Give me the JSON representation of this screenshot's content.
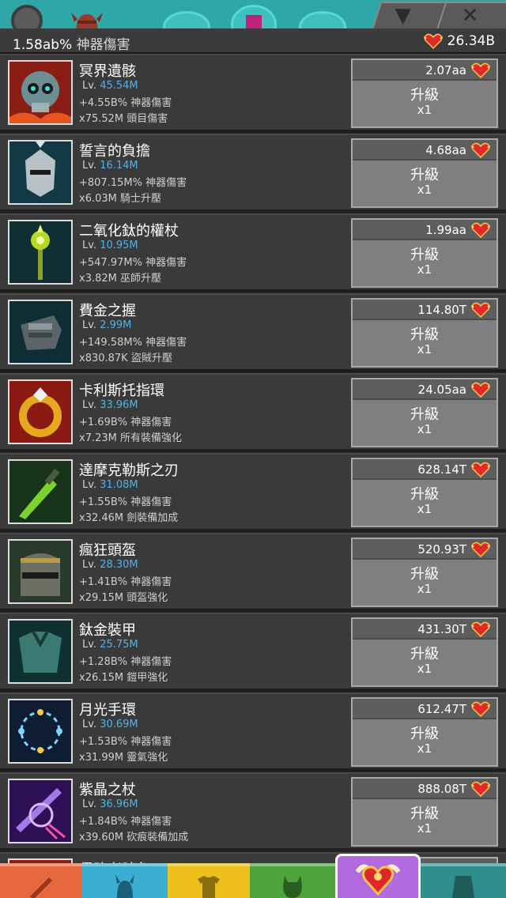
{
  "header": {
    "damage_value": "1.58ab%",
    "damage_label": "神器傷害",
    "currency_value": "26.34B",
    "currency_icon": "relic-heart-icon"
  },
  "list": {
    "items": [
      {
        "name": "冥界遺骸",
        "lv_label": "Lv.",
        "lv": "45.54M",
        "stat1": "+4.55B% 神器傷害",
        "stat2": "x75.52M 頭目傷害",
        "cost": "2.07aa",
        "button_label": "升級",
        "multiplier": "x1",
        "icon": "skull-icon"
      },
      {
        "name": "誓言的負擔",
        "lv_label": "Lv.",
        "lv": "16.14M",
        "stat1": "+807.15M% 神器傷害",
        "stat2": "x6.03M 騎士升壓",
        "cost": "4.68aa",
        "button_label": "升級",
        "multiplier": "x1",
        "icon": "knight-helm-icon"
      },
      {
        "name": "二氧化鈦的權杖",
        "lv_label": "Lv.",
        "lv": "10.95M",
        "stat1": "+547.97M% 神器傷害",
        "stat2": "x3.82M 巫師升壓",
        "cost": "1.99aa",
        "button_label": "升級",
        "multiplier": "x1",
        "icon": "scepter-icon"
      },
      {
        "name": "費金之握",
        "lv_label": "Lv.",
        "lv": "2.99M",
        "stat1": "+149.58M% 神器傷害",
        "stat2": "x830.87K 盜賊升壓",
        "cost": "114.80T",
        "button_label": "升級",
        "multiplier": "x1",
        "icon": "gauntlet-icon"
      },
      {
        "name": "卡利斯托指環",
        "lv_label": "Lv.",
        "lv": "33.96M",
        "stat1": "+1.69B% 神器傷害",
        "stat2": "x7.23M 所有裝備強化",
        "cost": "24.05aa",
        "button_label": "升級",
        "multiplier": "x1",
        "icon": "ring-icon"
      },
      {
        "name": "達摩克勒斯之刃",
        "lv_label": "Lv.",
        "lv": "31.08M",
        "stat1": "+1.55B% 神器傷害",
        "stat2": "x32.46M 劍裝備加成",
        "cost": "628.14T",
        "button_label": "升級",
        "multiplier": "x1",
        "icon": "blade-icon"
      },
      {
        "name": "瘋狂頭盔",
        "lv_label": "Lv.",
        "lv": "28.30M",
        "stat1": "+1.41B% 神器傷害",
        "stat2": "x29.15M 頭盔強化",
        "cost": "520.93T",
        "button_label": "升級",
        "multiplier": "x1",
        "icon": "helmet-icon"
      },
      {
        "name": "鈦金裝甲",
        "lv_label": "Lv.",
        "lv": "25.75M",
        "stat1": "+1.28B% 神器傷害",
        "stat2": "x26.15M 鎧甲強化",
        "cost": "431.30T",
        "button_label": "升級",
        "multiplier": "x1",
        "icon": "armor-icon"
      },
      {
        "name": "月光手環",
        "lv_label": "Lv.",
        "lv": "30.69M",
        "stat1": "+1.53B% 神器傷害",
        "stat2": "x31.99M 靈氣強化",
        "cost": "612.47T",
        "button_label": "升級",
        "multiplier": "x1",
        "icon": "bracelet-icon"
      },
      {
        "name": "紫晶之杖",
        "lv_label": "Lv.",
        "lv": "36.96M",
        "stat1": "+1.84B% 神器傷害",
        "stat2": "x39.60M 砍痕裝備加成",
        "cost": "888.08T",
        "button_label": "升級",
        "multiplier": "x1",
        "icon": "amethyst-staff-icon"
      }
    ]
  },
  "partial_row": {
    "name": "侵略者號角"
  },
  "bottom_nav": [
    {
      "name": "sword-tab-icon",
      "color": "#e8683e",
      "active": false
    },
    {
      "name": "viking-helmet-tab-icon",
      "color": "#3aaed0",
      "active": false
    },
    {
      "name": "shirt-tab-icon",
      "color": "#ecbf1a",
      "active": false
    },
    {
      "name": "pet-tab-icon",
      "color": "#4ea33c",
      "active": false
    },
    {
      "name": "relic-heart-tab-icon",
      "color": "#b46adf",
      "active": true
    },
    {
      "name": "shop-tab-icon",
      "color": "#2f8f8c",
      "active": false
    }
  ],
  "colors": {
    "level_blue": "#4fb3ea",
    "button_gray": "#7f7f7f",
    "row_bg": "#3a3a3a"
  }
}
